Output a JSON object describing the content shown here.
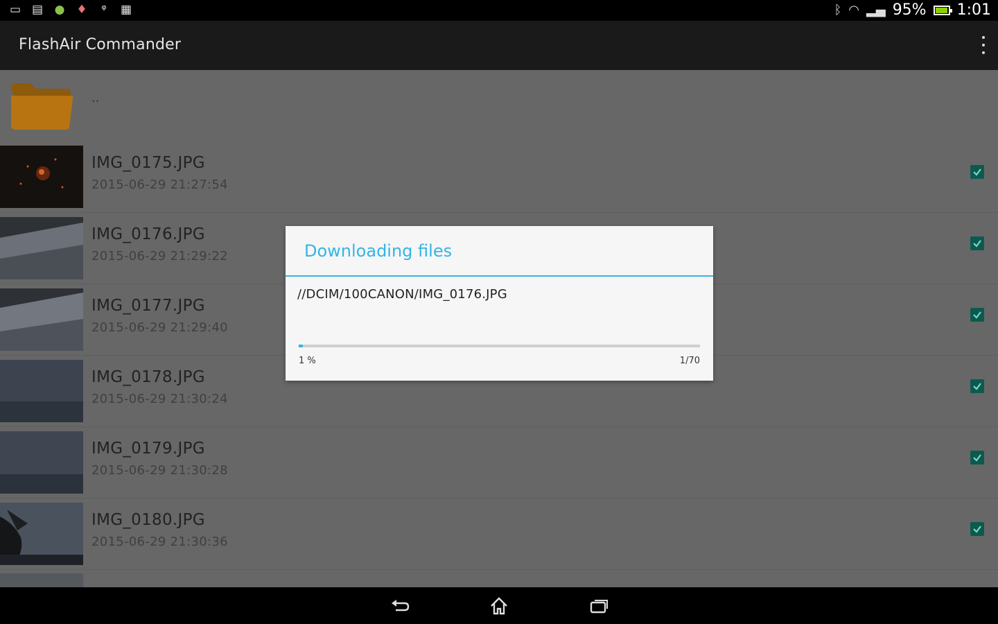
{
  "status_bar": {
    "left_icons": [
      "screenshot-icon",
      "store-icon",
      "android-icon",
      "location-icon",
      "usb-icon",
      "gallery-icon"
    ],
    "right_icons": [
      "bluetooth-icon",
      "wifi-icon",
      "signal-icon",
      "battery-icon"
    ],
    "battery": "95%",
    "time": "1:01"
  },
  "action_bar": {
    "title": "FlashAir Commander",
    "overflow_icon": "overflow-menu-icon"
  },
  "list": {
    "parent_label": "..",
    "files": [
      {
        "name": "IMG_0175.JPG",
        "date": "2015-06-29 21:27:54",
        "checked": true
      },
      {
        "name": "IMG_0176.JPG",
        "date": "2015-06-29 21:29:22",
        "checked": true
      },
      {
        "name": "IMG_0177.JPG",
        "date": "2015-06-29 21:29:40",
        "checked": true
      },
      {
        "name": "IMG_0178.JPG",
        "date": "2015-06-29 21:30:24",
        "checked": true
      },
      {
        "name": "IMG_0179.JPG",
        "date": "2015-06-29 21:30:28",
        "checked": true
      },
      {
        "name": "IMG_0180.JPG",
        "date": "2015-06-29 21:30:36",
        "checked": true
      }
    ]
  },
  "dialog": {
    "title": "Downloading files",
    "path": "//DCIM/100CANON/IMG_0176.JPG",
    "progress_fraction": 0.01,
    "percent_label": "1 %",
    "count_label": "1/70"
  },
  "colors": {
    "accent": "#33b5e5",
    "checkbox": "#0c5a4f",
    "folder": "#b77410"
  },
  "nav_bar": {
    "icons": [
      "back-icon",
      "home-icon",
      "recent-apps-icon"
    ]
  }
}
